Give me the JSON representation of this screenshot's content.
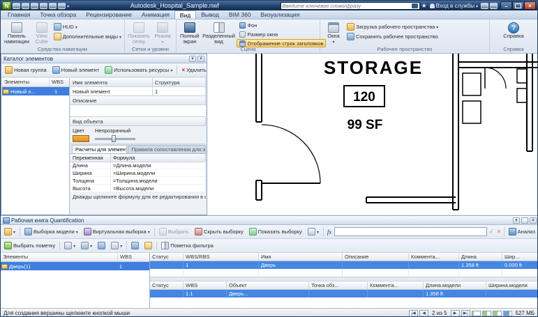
{
  "titlebar": {
    "logo": "N",
    "title": "Autodesk_Hospital_Sample.nwf",
    "search_placeholder": "Введите ключевое слово/фразу",
    "signin": "Вход в службы"
  },
  "tabs": [
    "Главная",
    "Точка обзора",
    "Рецензирование",
    "Анимация",
    "Вид",
    "Вывод",
    "BIM 360",
    "Визуализация"
  ],
  "ribbon": {
    "nav": {
      "label": "Средства навигации",
      "panel": "Панель навигации",
      "cube": "View Cube",
      "hud": "HUD",
      "views": "Дополнительные виды"
    },
    "grids": {
      "label": "Сетки и уровни",
      "show": "Показать сетку",
      "mode": "Режим"
    },
    "scene": {
      "label": "Сцена",
      "full": "Полный экран",
      "split": "Разделенный вид",
      "bg": "Фон",
      "size": "Размер окна",
      "titles": "Отображение строк заголовков"
    },
    "workspace": {
      "label": "Рабочее пространство",
      "windows": "Окна",
      "load": "Загрузка рабочего пространства",
      "save": "Сохранить рабочее пространство"
    },
    "help": {
      "label": "Справка",
      "help": "Справка"
    }
  },
  "catalog": {
    "title": "Каталог элементов",
    "toolbar": {
      "new_group": "Новая группа",
      "new_item": "Новый элемент",
      "use_resources": "Использовать ресурсы",
      "delete": "Удалить"
    },
    "tree": {
      "items": "Элементы",
      "wbs": "WBS",
      "row": "Новый э...",
      "row_wbs": "1"
    },
    "props": {
      "name": "Имя элемента",
      "structure": "Структура",
      "name_value": "Новый элемент",
      "structure_value": "1",
      "description": "Описание",
      "appearance": "Вид объекта",
      "color": "Цвет",
      "opacity": "Непрозрачный",
      "tab1": "Расчеты для элемента",
      "tab2": "Правила сопоставления для эл...",
      "var": "Переменная",
      "formula": "Формула",
      "rows": [
        {
          "v": "Длина",
          "f": "=Длина.модели"
        },
        {
          "v": "Ширина",
          "f": "=Ширина.модели"
        },
        {
          "v": "Толщина",
          "f": "=Толщина.модели"
        },
        {
          "v": "Высота",
          "f": "=Высота.модели"
        }
      ],
      "hint": "Дважды щелкните формулу для ее редактирования в ст..."
    }
  },
  "viewport": {
    "room": "STORAGE",
    "number": "120",
    "area": "99 SF"
  },
  "workbook": {
    "title": "Рабочая книга Quantification",
    "t1": {
      "takeoff": "Выборка модели",
      "virtual": "Виртуальная выборка",
      "select": "Выбрать",
      "hide": "Скрыть выборку",
      "show": "Показать выборку",
      "fx": "fx",
      "analyze": "Анализ"
    },
    "t2": {
      "pick": "Выбрать пометку",
      "filter": "Пометка фильтра"
    },
    "tree": {
      "items": "Элементы",
      "wbs": "WBS",
      "row": "Дверь(1)",
      "row_wbs": "1"
    },
    "itemsTable": {
      "h": [
        "Статус",
        "WBS/RBS",
        "Имя",
        "Описание",
        "Коммента...",
        "Длина",
        "Шир..."
      ],
      "r": [
        "",
        "1",
        "Дверь",
        "",
        "",
        "1.358 ft",
        "0.000 ft"
      ]
    },
    "objectsTable": {
      "h": [
        "Статус",
        "WBS",
        "Объект",
        "Точка обз...",
        "Коммента...",
        "Длина.модели",
        "Ширина.модели"
      ],
      "r": [
        "",
        "1.1",
        "Дверь...",
        "",
        "",
        "1.358 ft",
        ""
      ]
    }
  },
  "statusbar": {
    "hint": "Для создания вершины щелкните кнопкой мыши",
    "page": "2 из 5",
    "memory": "527 МБ"
  }
}
